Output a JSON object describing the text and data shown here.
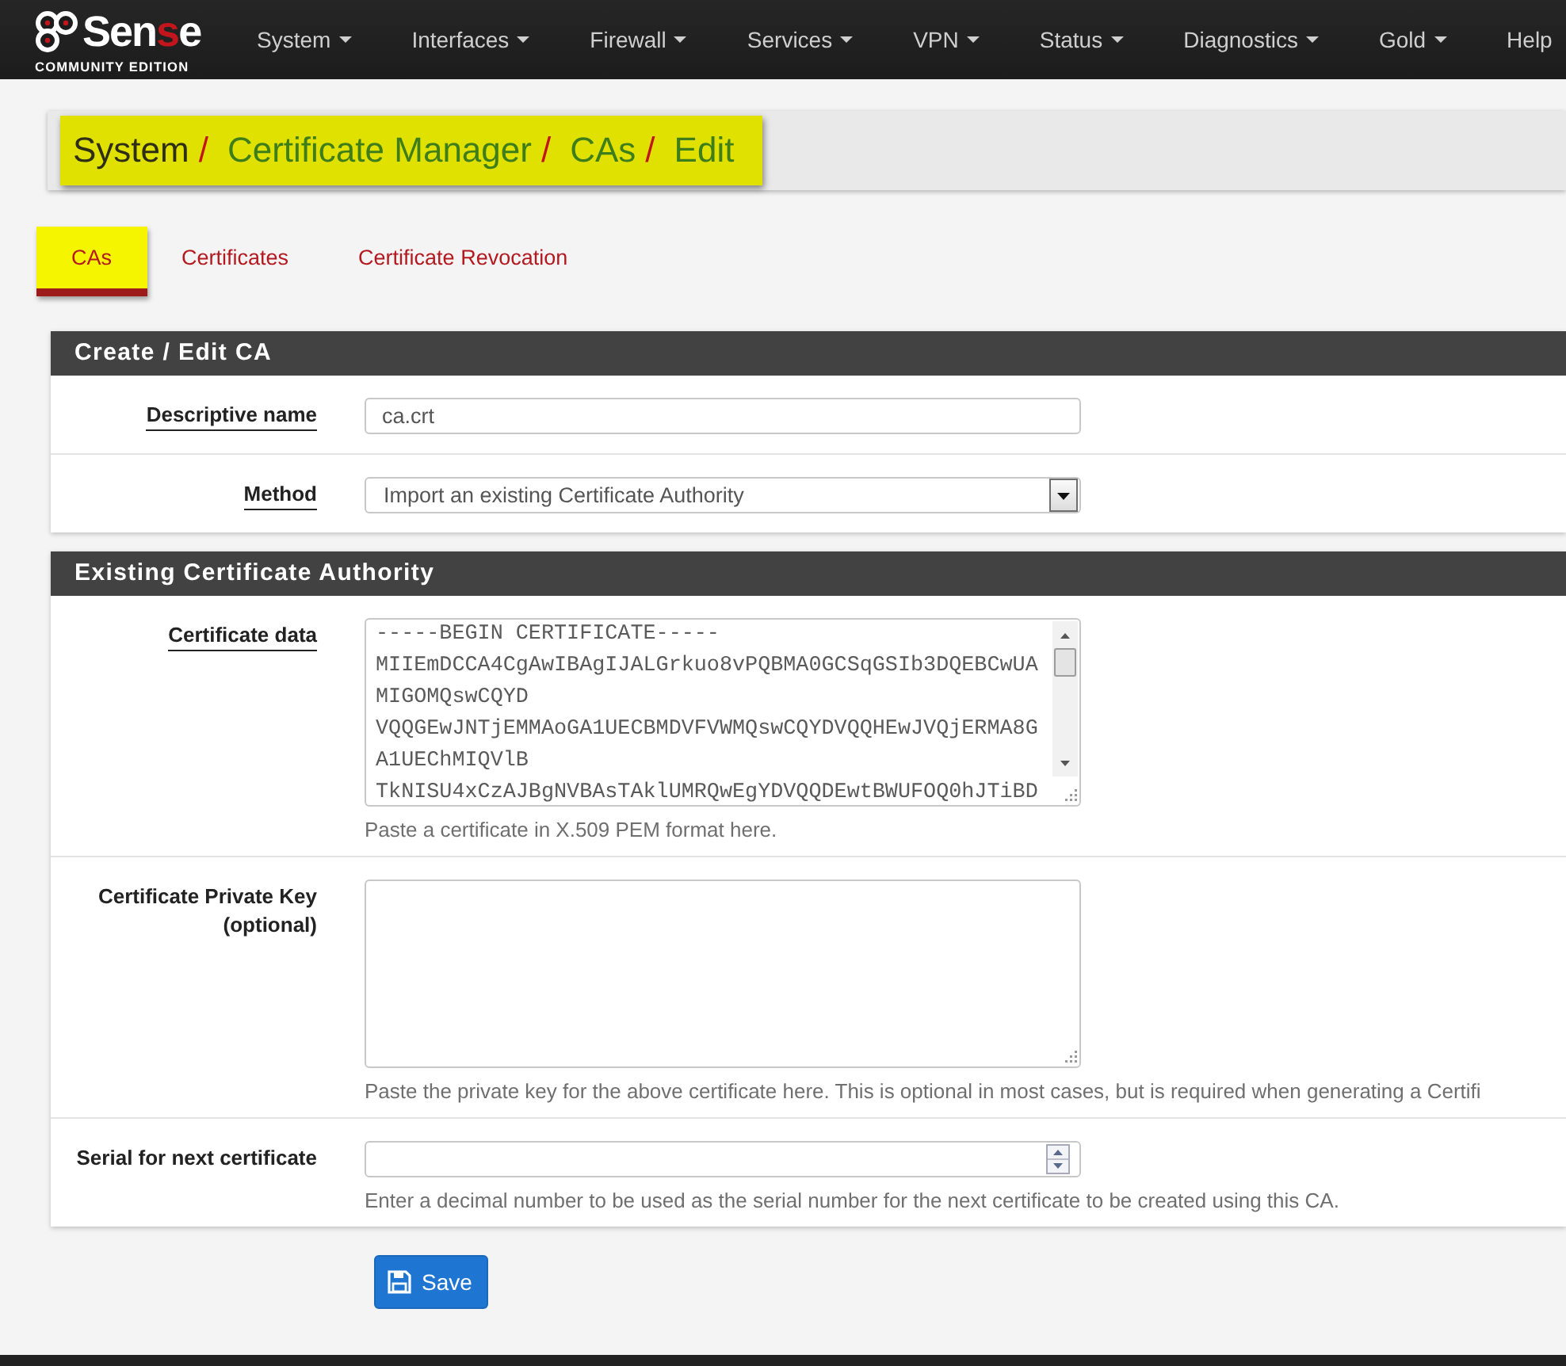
{
  "navbar": {
    "logo": {
      "parts": [
        {
          "text": "Sen",
          "accent": false
        },
        {
          "text": "s",
          "accent": true
        },
        {
          "text": "e",
          "accent": false
        }
      ],
      "tagline": "COMMUNITY EDITION"
    },
    "menu": [
      {
        "label": "System",
        "caret": true
      },
      {
        "label": "Interfaces",
        "caret": true
      },
      {
        "label": "Firewall",
        "caret": true
      },
      {
        "label": "Services",
        "caret": true
      },
      {
        "label": "VPN",
        "caret": true
      },
      {
        "label": "Status",
        "caret": true
      },
      {
        "label": "Diagnostics",
        "caret": true
      },
      {
        "label": "Gold",
        "caret": true
      },
      {
        "label": "Help",
        "caret": false
      }
    ]
  },
  "breadcrumb": {
    "highlighted": true,
    "items": [
      {
        "text": "System",
        "kind": "plain",
        "separator": "/"
      },
      {
        "text": "Certificate Manager",
        "kind": "link",
        "separator": "/"
      },
      {
        "text": "CAs",
        "kind": "link",
        "separator": "/"
      },
      {
        "text": "Edit",
        "kind": "link"
      }
    ]
  },
  "tabs": [
    {
      "label": "CAs",
      "selected": true,
      "highlighted": true
    },
    {
      "label": "Certificates",
      "selected": false,
      "highlighted": false
    },
    {
      "label": "Certificate Revocation",
      "selected": false,
      "highlighted": false
    }
  ],
  "panels": [
    {
      "title": "Create / Edit CA",
      "rows": [
        {
          "label": "Descriptive name",
          "required": true,
          "kind": "text",
          "value": "ca.crt"
        },
        {
          "label": "Method",
          "required": true,
          "kind": "select",
          "value": "Import an existing Certificate Authority"
        }
      ]
    },
    {
      "title": "Existing Certificate Authority",
      "rows": [
        {
          "label": "Certificate data",
          "required": true,
          "kind": "textarea",
          "lines": [
            "-----BEGIN CERTIFICATE-----",
            "MIIEmDCCA4CgAwIBAgIJALGrkuo8vPQBMA0GCSqGSIb3DQEBCwUA",
            "MIGOMQswCQYD",
            "VQQGEwJNTjEMMAoGA1UECBMDVFVWMQswCQYDVQQHEwJVQjERMA8G",
            "A1UEChMIQVlB",
            "TkNISU4xCzAJBgNVBAsTAklUMRQwEgYDVQQDEwtBWUFOQ0hJTiBD"
          ],
          "help": "Paste a certificate in X.509 PEM format here."
        },
        {
          "label": "Certificate Private Key (optional)",
          "required": false,
          "kind": "textarea",
          "help": "Paste the private key for the above certificate here. This is optional in most cases, but is required when generating a Certifi"
        },
        {
          "label": "Serial for next certificate",
          "required": false,
          "kind": "number",
          "help": "Enter a decimal number to be used as the serial number for the next certificate to be created using this CA."
        }
      ]
    }
  ],
  "save_button": {
    "label": "Save"
  }
}
